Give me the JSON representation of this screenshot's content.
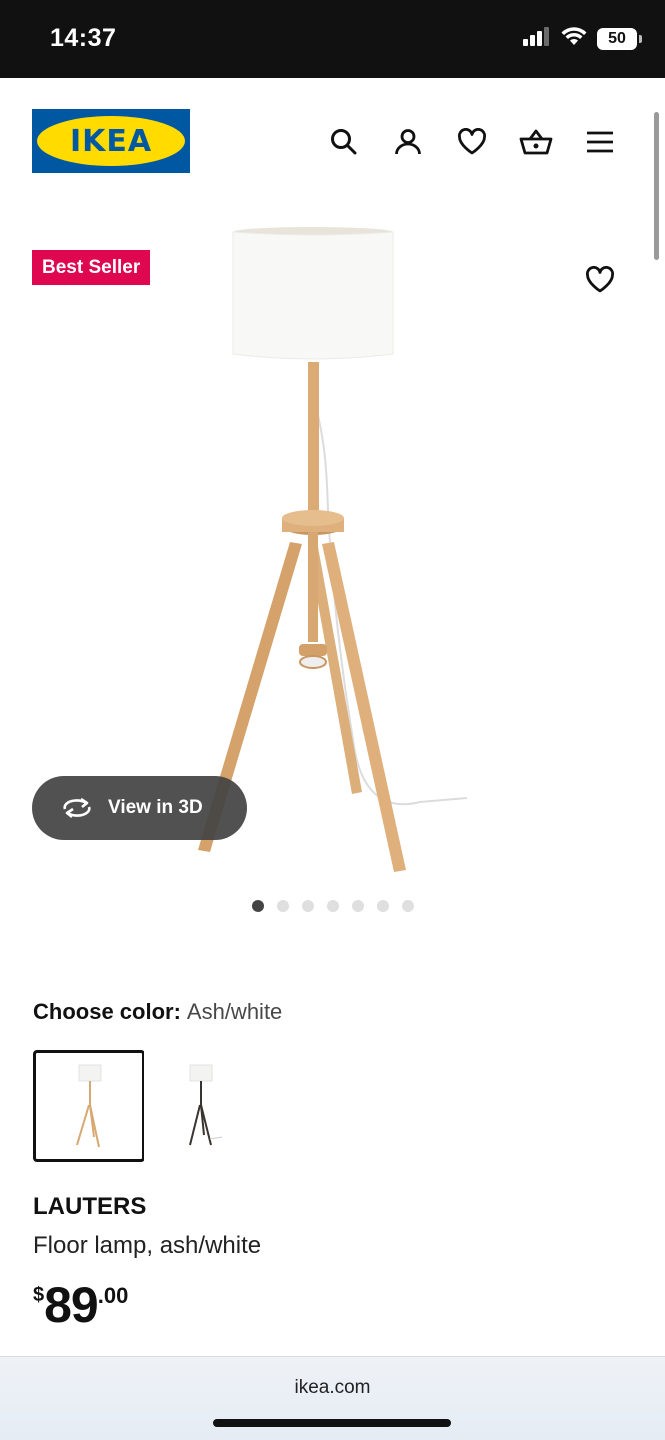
{
  "status_bar": {
    "time": "14:37",
    "battery": "50"
  },
  "header": {
    "logo_text": "IKEA",
    "icons": [
      "search-icon",
      "account-icon",
      "heart-icon",
      "basket-icon",
      "menu-icon"
    ]
  },
  "gallery": {
    "badge": "Best Seller",
    "view_3d_label": "View in 3D",
    "image_count": 7,
    "active_image": 1
  },
  "color_choice": {
    "label": "Choose color:",
    "value": "Ash/white",
    "options": [
      "Ash/white",
      "Black-brown/white"
    ]
  },
  "product": {
    "name": "LAUTERS",
    "description": "Floor lamp, ash/white",
    "price_currency": "$",
    "price_integer": "89",
    "price_decimal": ".00"
  },
  "browser": {
    "url": "ikea.com"
  },
  "colors": {
    "brand_blue": "#0058a3",
    "brand_yellow": "#ffdb00",
    "badge_red": "#e00751"
  }
}
